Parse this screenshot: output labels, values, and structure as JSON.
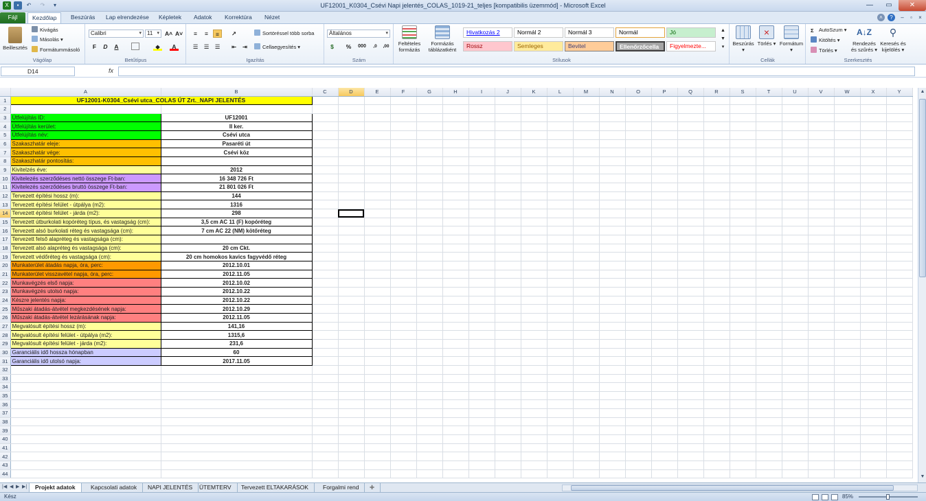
{
  "window": {
    "title": "UF12001_K0304_Csévi Napi jelentés_COLAS_1019-21_teljes  [kompatibilis üzemmód]  -  Microsoft Excel",
    "minimize": "—",
    "maximize": "▭",
    "close": "✕"
  },
  "tabs": [
    {
      "label": "Fájl"
    },
    {
      "label": "Kezdőlap"
    },
    {
      "label": "Beszúrás"
    },
    {
      "label": "Lap elrendezése"
    },
    {
      "label": "Képletek"
    },
    {
      "label": "Adatok"
    },
    {
      "label": "Korrektúra"
    },
    {
      "label": "Nézet"
    }
  ],
  "ribbon": {
    "clipboard": {
      "label": "Vágólap",
      "paste": "Beillesztés",
      "cut": "Kivágás",
      "copy": "Másolás",
      "painter": "Formátummásoló"
    },
    "font": {
      "label": "Betűtípus",
      "name": "Calibri",
      "size": "11",
      "bold": "F",
      "italic": "D",
      "underline": "A",
      "grow": "A˄",
      "shrink": "A˅"
    },
    "alignment": {
      "label": "Igazítás",
      "wrap": "Sortöréssel több sorba",
      "merge": "Cellaegyesítés"
    },
    "number": {
      "label": "Szám",
      "format": "Általános",
      "percent": "%",
      "thousands": "000",
      "dec_inc": ",0",
      "dec_dec": ",00"
    },
    "styles": {
      "label": "Stílusok",
      "conditional": "Feltételes formázás",
      "as_table": "Formázás táblázatként",
      "items": [
        {
          "label": "Hivatkozás 2",
          "bg": "#ffffff",
          "fg": "#0000ff"
        },
        {
          "label": "Normál 2",
          "bg": "#ffffff",
          "fg": "#000000"
        },
        {
          "label": "Normál 3",
          "bg": "#ffffff",
          "fg": "#000000"
        },
        {
          "label": "Normál",
          "bg": "#ffffff",
          "fg": "#000000"
        },
        {
          "label": "Jó",
          "bg": "#c6efce",
          "fg": "#006100"
        },
        {
          "label": "Rossz",
          "bg": "#ffc7ce",
          "fg": "#9c0006"
        },
        {
          "label": "Semleges",
          "bg": "#ffeb9c",
          "fg": "#9c6500"
        },
        {
          "label": "Bevitel",
          "bg": "#ffcc99",
          "fg": "#3f3f76"
        },
        {
          "label": "Ellenőrzőcella",
          "bg": "#a5a5a5",
          "fg": "#ffffff"
        },
        {
          "label": "Figyelmezte...",
          "bg": "#ffffff",
          "fg": "#ff0000"
        }
      ]
    },
    "cells": {
      "label": "Cellák",
      "insert": "Beszúrás",
      "delete": "Törlés",
      "format": "Formátum"
    },
    "editing": {
      "label": "Szerkesztés",
      "autosum": "AutoSzum",
      "fill": "Kitöltés",
      "clear": "Törlés",
      "sort": "Rendezés és szűrés",
      "find": "Keresés és kijelölés"
    }
  },
  "formula_bar": {
    "name_box": "D14",
    "fx": "fx",
    "formula": ""
  },
  "grid": {
    "columns": [
      "A",
      "B",
      "C",
      "D",
      "E",
      "F",
      "G",
      "H",
      "I",
      "J",
      "K",
      "L",
      "M",
      "N",
      "O",
      "P",
      "Q",
      "R",
      "S",
      "T",
      "U",
      "V",
      "W",
      "X",
      "Y"
    ],
    "selected_col": "D",
    "selected_row": 14,
    "row_count": 44,
    "title": "UF12001-K0304_Csévi utca_COLAS ÚT Zrt._NAPI JELENTÉS",
    "rows": [
      {
        "row": 3,
        "label": "Útfelújítás ID:",
        "value": "UF12001",
        "color": "#00ff00"
      },
      {
        "row": 4,
        "label": "Útfelújítás kerület:",
        "value": "II ker.",
        "color": "#00ff00"
      },
      {
        "row": 5,
        "label": "Útfelújítás név:",
        "value": "Csévi utca",
        "color": "#00ff00"
      },
      {
        "row": 6,
        "label": "Szakaszhatár eleje:",
        "value": "Pasaréti út",
        "color": "#ffc000"
      },
      {
        "row": 7,
        "label": "Szakaszhatár vége:",
        "value": "Csévi köz",
        "color": "#ffc000"
      },
      {
        "row": 8,
        "label": "Szakaszhatár pontosítás:",
        "value": "",
        "color": "#ffc000"
      },
      {
        "row": 9,
        "label": "Kivitelzés éve:",
        "value": "2012",
        "color": "#ffff99"
      },
      {
        "row": 10,
        "label": "Kivitelezés szerződéses nettó összege Ft-ban:",
        "value": "16 348 726 Ft",
        "color": "#cc99ff"
      },
      {
        "row": 11,
        "label": "Kivitelezés szerződéses bruttó összege Ft-ban:",
        "value": "21 801 026 Ft",
        "color": "#cc99ff"
      },
      {
        "row": 12,
        "label": "Tervezett építési hossz (m):",
        "value": "144",
        "color": "#ffff99"
      },
      {
        "row": 13,
        "label": "Tervezett építési felület - útpálya (m2):",
        "value": "1316",
        "color": "#ffff99"
      },
      {
        "row": 14,
        "label": "Tervezett építési felület - járda (m2):",
        "value": "298",
        "color": "#ffff99"
      },
      {
        "row": 15,
        "label": "Tervezett útburkolati kopóréteg típus, és vastagság (cm):",
        "value": "3,5 cm AC 11 (F) kopóréteg",
        "color": "#ffff99"
      },
      {
        "row": 16,
        "label": "Tervezett alsó burkolati réteg és vastagsága (cm):",
        "value": "7 cm AC 22 (NM) kötőréteg",
        "color": "#ffff99"
      },
      {
        "row": 17,
        "label": "Tervezett felső alapréteg és vastagsága (cm):",
        "value": "",
        "color": "#ffff99"
      },
      {
        "row": 18,
        "label": "Tervezett alsó alapréteg és vastagsága (cm):",
        "value": "20 cm Ckt.",
        "color": "#ffff99"
      },
      {
        "row": 19,
        "label": "Tervezett védőréteg és vastagsága (cm):",
        "value": "20 cm homokos kavics fagyvédő réteg",
        "color": "#ffff99"
      },
      {
        "row": 20,
        "label": "Munkaterület átadás napja, óra, perc:",
        "value": "2012.10.01",
        "color": "#ff9900"
      },
      {
        "row": 21,
        "label": "Munkaterület visszavétel napja, óra, perc:",
        "value": "2012.11.05",
        "color": "#ff9900"
      },
      {
        "row": 22,
        "label": "Munkavégzés első napja:",
        "value": "2012.10.02",
        "color": "#ff8080"
      },
      {
        "row": 23,
        "label": "Munkavégzés utolsó  napja:",
        "value": "2012.10.22",
        "color": "#ff8080"
      },
      {
        "row": 24,
        "label": "Készre jelentés napja:",
        "value": "2012.10.22",
        "color": "#ff8080"
      },
      {
        "row": 25,
        "label": "Műszaki átadás-átvétel megkezdésének napja:",
        "value": "2012.10.29",
        "color": "#ff8080"
      },
      {
        "row": 26,
        "label": "Műszaki átadás-átvétel lezárásának napja:",
        "value": "2012.11.05",
        "color": "#ff8080"
      },
      {
        "row": 27,
        "label": "Megvalósult építési hossz (m):",
        "value": "141,16",
        "color": "#ffff99"
      },
      {
        "row": 28,
        "label": "Megvalósult építési felület - útpálya (m2):",
        "value": "1315,6",
        "color": "#ffff99"
      },
      {
        "row": 29,
        "label": "Megvalósult építési felület - járda (m2):",
        "value": "231,6",
        "color": "#ffff99"
      },
      {
        "row": 30,
        "label": "Garanciális idő hossza hónapban",
        "value": "60",
        "color": "#ccccff"
      },
      {
        "row": 31,
        "label": "Garanciális idő utolsó napja:",
        "value": "2017.11.05",
        "color": "#ccccff"
      }
    ]
  },
  "sheets": [
    {
      "label": "Projekt adatok",
      "active": true
    },
    {
      "label": "Kapcsolati adatok"
    },
    {
      "label": "NAPI JELENTÉS"
    },
    {
      "label": "ÜTEMTERV"
    },
    {
      "label": "Tervezett ELTAKARÁSOK"
    },
    {
      "label": "Forgalmi rend"
    }
  ],
  "status": {
    "ready": "Kész",
    "zoom": "85%"
  }
}
